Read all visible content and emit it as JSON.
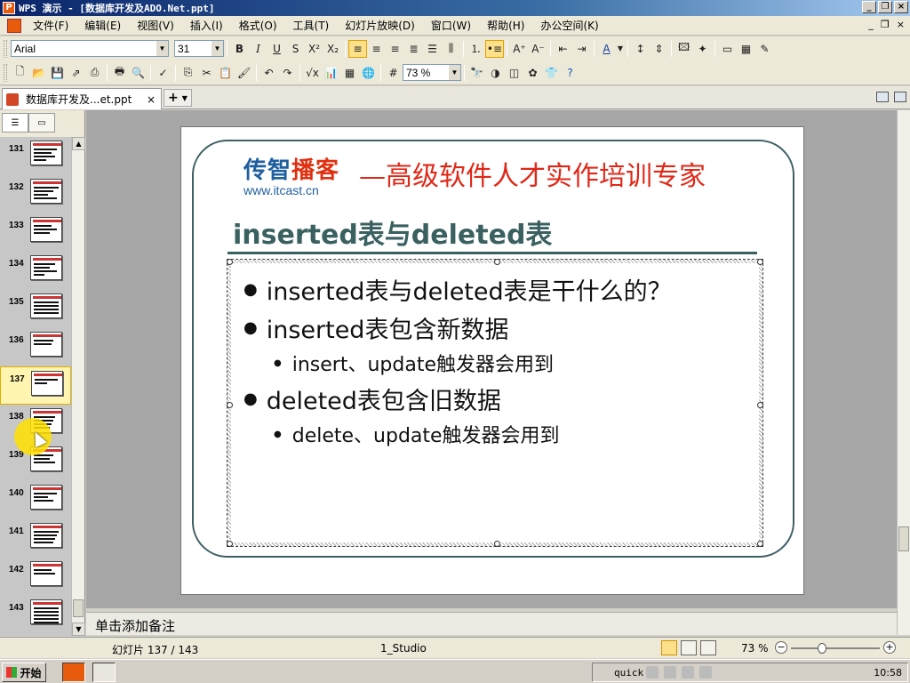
{
  "window": {
    "title": "WPS 演示 - [数据库开发及ADO.Net.ppt]",
    "app_icon_letter": "P"
  },
  "menubar": {
    "items": [
      "文件(F)",
      "编辑(E)",
      "视图(V)",
      "插入(I)",
      "格式(O)",
      "工具(T)",
      "幻灯片放映(D)",
      "窗口(W)",
      "帮助(H)",
      "办公空间(K)"
    ]
  },
  "format_toolbar": {
    "font_name": "Arial",
    "font_size": "31"
  },
  "standard_toolbar": {
    "zoom": "73 %"
  },
  "document_tab": {
    "label": "数据库开发及...et.ppt",
    "close": "×",
    "new_tab": "+"
  },
  "thumbnails": [
    {
      "num": "131"
    },
    {
      "num": "132"
    },
    {
      "num": "133"
    },
    {
      "num": "134"
    },
    {
      "num": "135"
    },
    {
      "num": "136"
    },
    {
      "num": "137"
    },
    {
      "num": "138"
    },
    {
      "num": "139"
    },
    {
      "num": "140"
    },
    {
      "num": "141"
    },
    {
      "num": "142"
    },
    {
      "num": "143"
    }
  ],
  "slide": {
    "logo_text_1": "传智",
    "logo_text_2": "播客",
    "logo_url": "www.itcast.cn",
    "tagline": "—高级软件人才实作培训专家",
    "title": "inserted表与deleted表",
    "bullets": [
      {
        "level": 1,
        "text": "inserted表与deleted表是干什么的？"
      },
      {
        "level": 1,
        "text": "inserted表包含新数据"
      },
      {
        "level": 2,
        "text": "insert、update触发器会用到"
      },
      {
        "level": 1,
        "text": "deleted表包含旧数据"
      },
      {
        "level": 2,
        "text": "delete、update触发器会用到"
      }
    ]
  },
  "notes": {
    "placeholder": "单击添加备注"
  },
  "statusbar": {
    "slide_info": "幻灯片 137 / 143",
    "design": "1_Studio",
    "zoom": "73 %"
  },
  "taskbar": {
    "start": "开始",
    "ime": "quick",
    "clock": "10:58"
  }
}
